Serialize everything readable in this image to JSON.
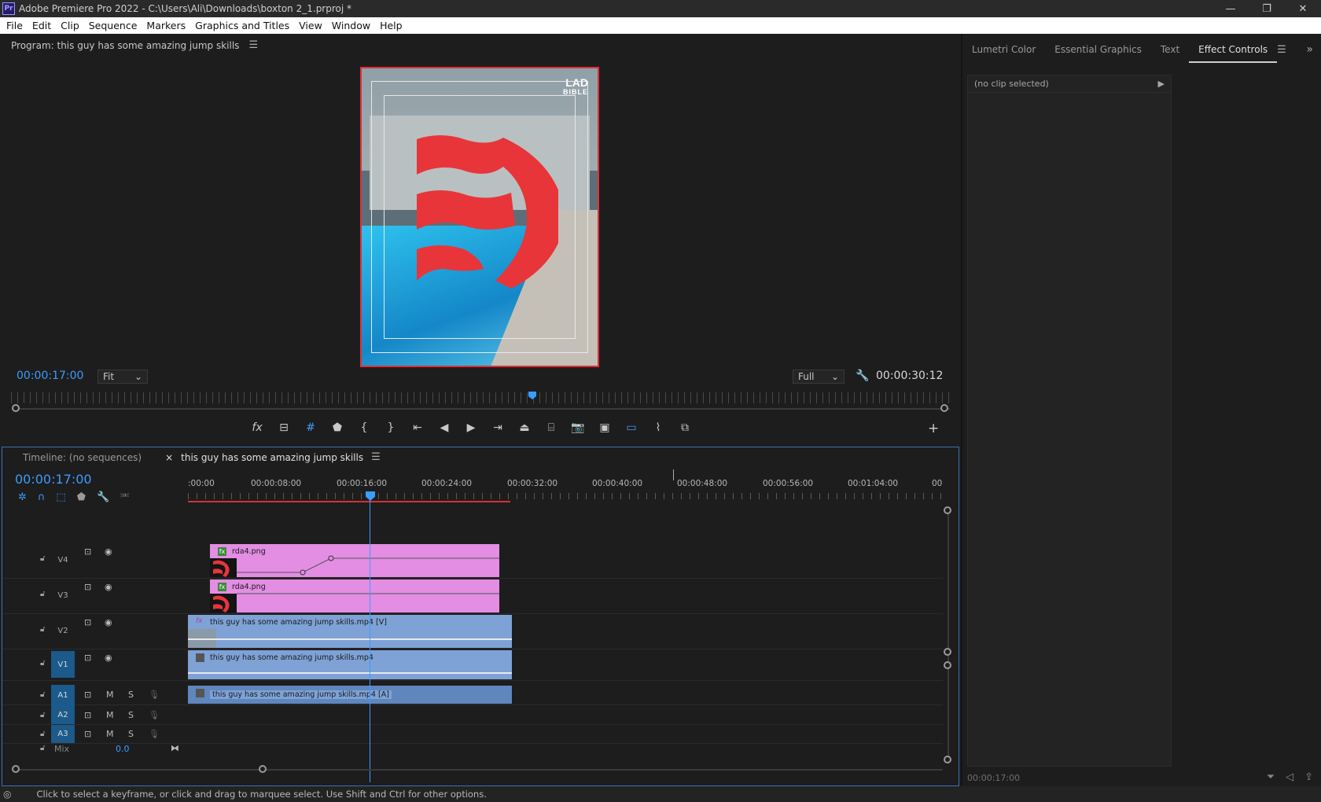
{
  "window": {
    "title": "Adobe Premiere Pro 2022 - C:\\Users\\Ali\\Downloads\\boxton 2_1.prproj *",
    "logo": "Pr",
    "min": "—",
    "restore": "❐",
    "close": "✕"
  },
  "menu": [
    "File",
    "Edit",
    "Clip",
    "Sequence",
    "Markers",
    "Graphics and Titles",
    "View",
    "Window",
    "Help"
  ],
  "program_monitor": {
    "title": "Program: this guy has some amazing jump skills",
    "current_tc": "00:00:17:00",
    "duration_tc": "00:00:30:12",
    "zoom": "Fit",
    "resolution": "Full",
    "overlay_logo_top": "LAD",
    "overlay_logo_bottom": "BIBLE",
    "playhead_fraction": 0.552
  },
  "right_panel": {
    "tabs": [
      "Lumetri Color",
      "Essential Graphics",
      "Text",
      "Effect Controls"
    ],
    "active_tab": "Effect Controls",
    "no_clip": "(no clip selected)",
    "timecode": "00:00:17:00"
  },
  "timeline": {
    "tabs_inactive": "Timeline: (no sequences)",
    "tab_active": "this guy has some amazing jump skills",
    "timecode": "00:00:17:00",
    "ruler_labels": [
      ":00:00",
      "00:00:08:00",
      "00:00:16:00",
      "00:00:24:00",
      "00:00:32:00",
      "00:00:40:00",
      "00:00:48:00",
      "00:00:56:00",
      "00:01:04:00",
      "00"
    ],
    "tracks": {
      "v4": {
        "label": "V4",
        "clip": "rda4.png"
      },
      "v3": {
        "label": "V3",
        "clip": "rda4.png"
      },
      "v2": {
        "label": "V2",
        "clip": "this guy has some amazing jump skills.mp4 [V]"
      },
      "v1": {
        "label": "V1",
        "clip": "this guy has some amazing jump skills.mp4"
      },
      "a1": {
        "label": "A1",
        "clip": "this guy has some amazing jump skills.mp4 [A]"
      },
      "a2": {
        "label": "A2"
      },
      "a3": {
        "label": "A3"
      }
    },
    "mix_label": "Mix",
    "mix_value": "0.0",
    "m_label": "M",
    "s_label": "S"
  },
  "status": "Click to select a keyframe, or click and drag to marquee select. Use Shift and Ctrl for other options.",
  "colors": {
    "accent": "#3b9cff",
    "pink_clip": "#e38de3",
    "video_clip": "#7ea2d6",
    "audio_clip": "#5f86bd",
    "red_logo": "#e8353a"
  }
}
